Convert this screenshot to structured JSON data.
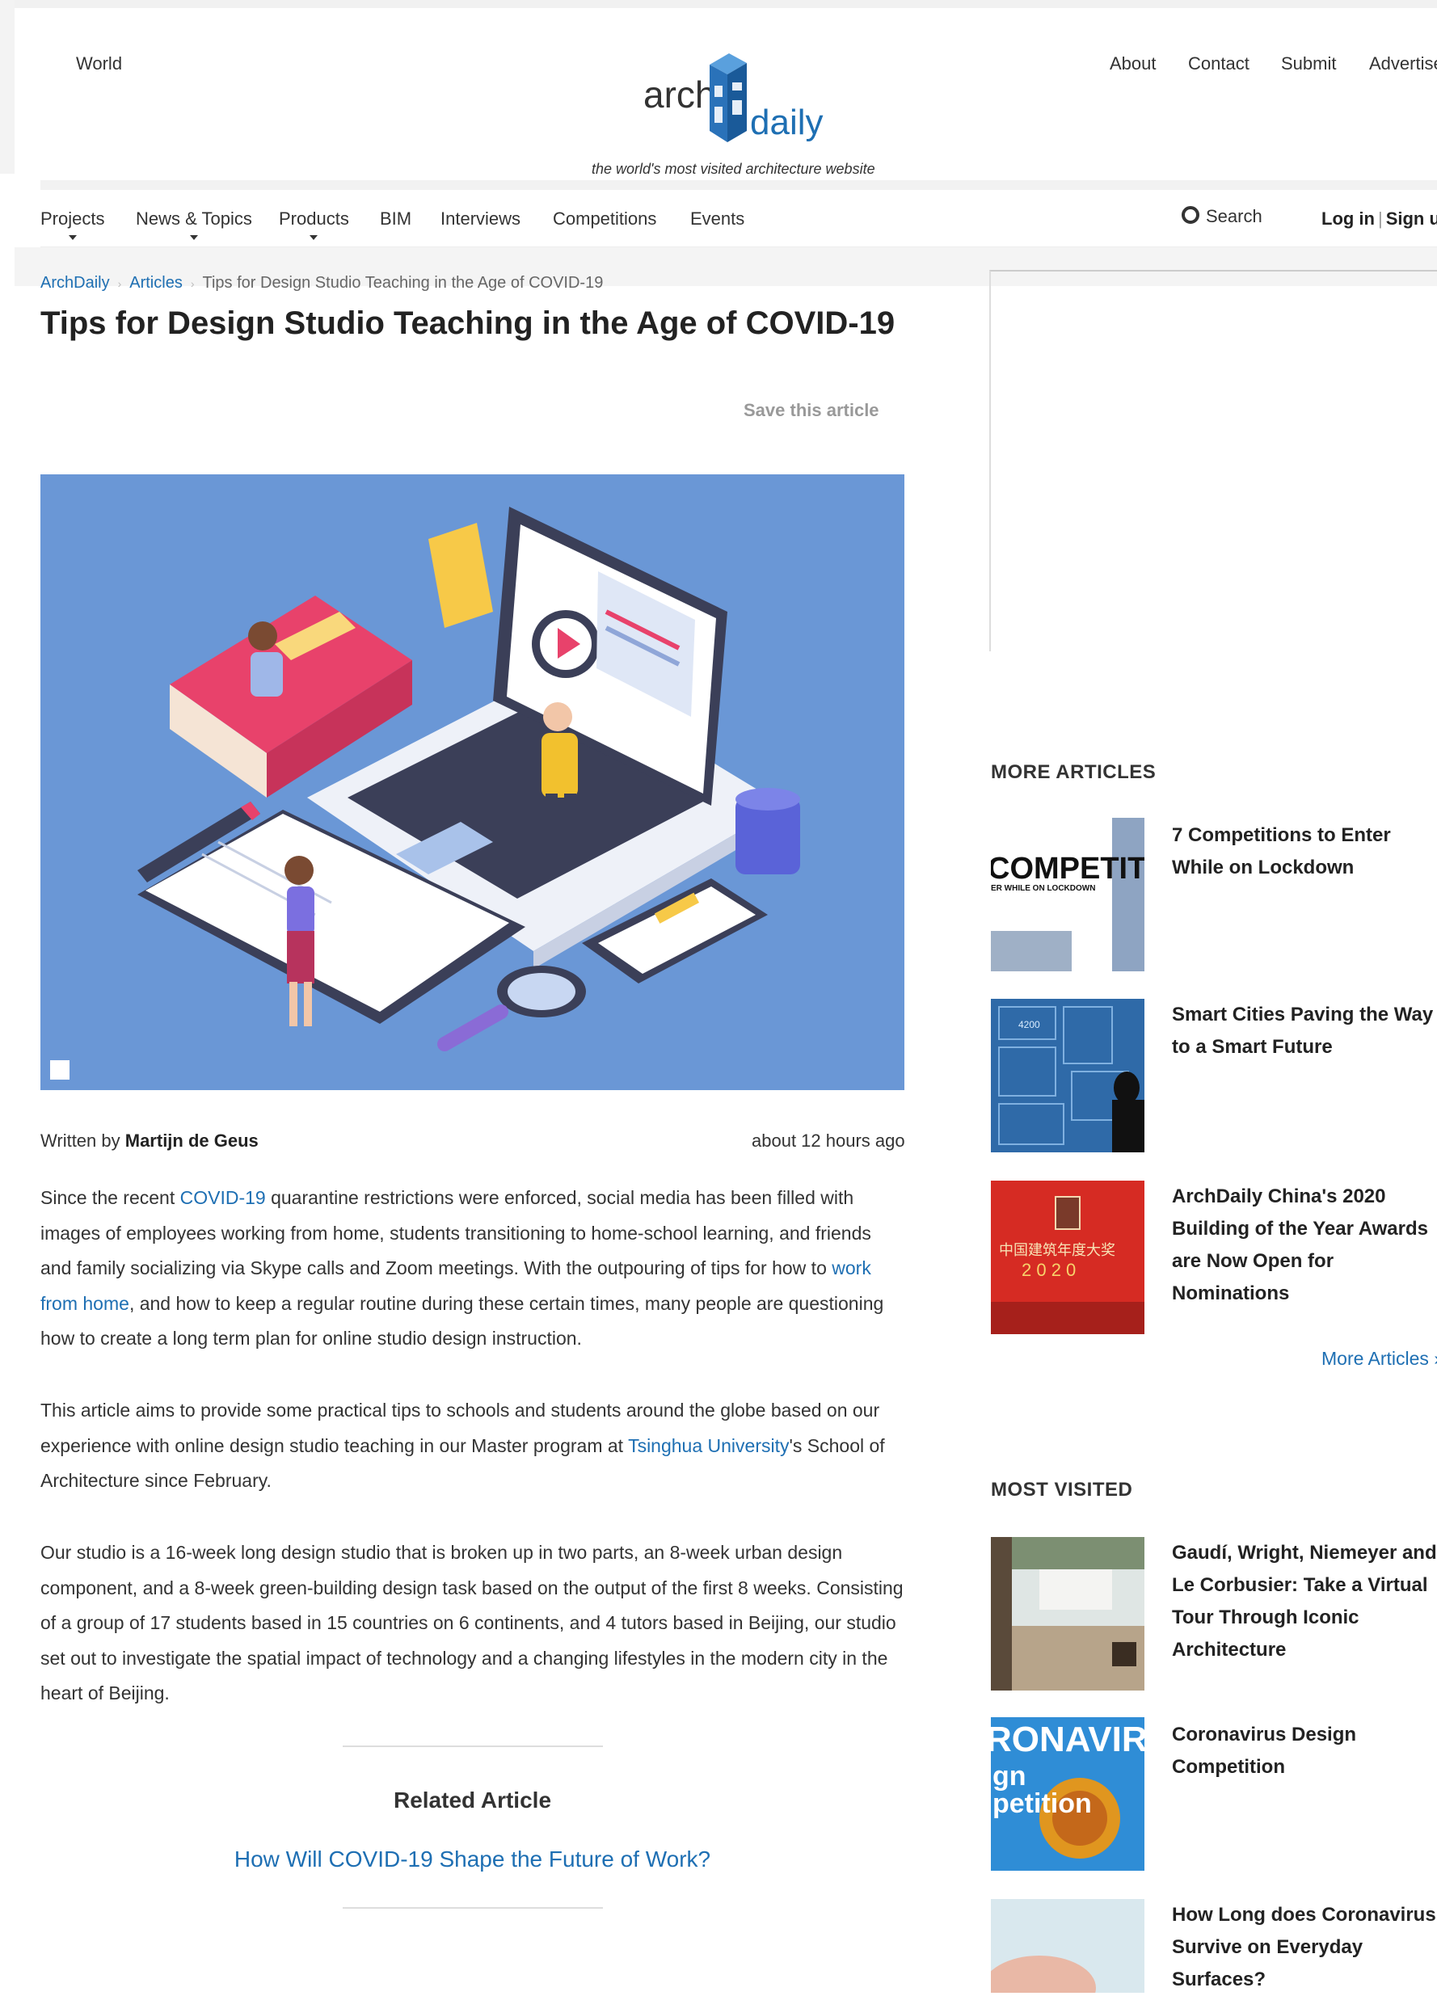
{
  "header": {
    "world_label": "World",
    "top_links": [
      "About",
      "Contact",
      "Submit",
      "Advertise"
    ],
    "logo_arch": "arch",
    "logo_daily": "daily",
    "tagline": "the world's most visited architecture website"
  },
  "nav": {
    "items": [
      {
        "label": "Projects",
        "has_menu": true
      },
      {
        "label": "News & Topics",
        "has_menu": true
      },
      {
        "label": "Products",
        "has_menu": true
      },
      {
        "label": "BIM",
        "has_menu": false
      },
      {
        "label": "Interviews",
        "has_menu": false
      },
      {
        "label": "Competitions",
        "has_menu": false
      },
      {
        "label": "Events",
        "has_menu": false
      }
    ],
    "search_label": "Search",
    "login_label": "Log in",
    "signup_label": "Sign up"
  },
  "breadcrumb": [
    "ArchDaily",
    "Articles",
    "Tips for Design Studio Teaching in the Age of COVID-19"
  ],
  "article": {
    "title": "Tips for Design Studio Teaching in the Age of COVID-19",
    "save_label": "Save this article",
    "byline_prefix": "Written by",
    "author": "Martijn de Geus",
    "posted": "about 12 hours ago",
    "p1": {
      "t1": "Since the recent ",
      "l1": "COVID-19",
      "t2": " quarantine restrictions were enforced, social media has been filled with images of employees working from home, students transitioning to home-school learning, and friends and family socializing via Skype calls and Zoom meetings. With the outpouring of tips for how to ",
      "l2": "work from home",
      "t3": ", and how to keep a regular routine during these certain times, many people are questioning how to create a long term plan for online studio design instruction."
    },
    "p2": {
      "t1": "This article aims to provide some practical tips to schools and students around the globe based on our experience with online design studio teaching in our Master program at ",
      "l1": "Tsinghua University",
      "t2": "'s School of Architecture since February."
    },
    "p3": "Our studio is a 16-week long design studio that is broken up in two parts, an 8-week urban design component, and a 8-week green-building design task based on the output of the first 8 weeks. Consisting of a group of 17 students based in 15 countries on 6 continents, and 4 tutors based in Beijing, our studio set out to investigate the spatial impact of technology and a changing lifestyles in the modern city in the heart of Beijing.",
    "related_heading": "Related Article",
    "related_link": "How Will COVID-19 Shape the Future of Work?"
  },
  "sidebar": {
    "more_articles_heading": "MORE ARTICLES",
    "more_articles": [
      {
        "title": "7 Competitions to Enter While on Lockdown",
        "thumb_text": "COMPETITIO",
        "thumb_sub": "ER WHILE ON LOCKDOWN"
      },
      {
        "title": "Smart Cities Paving the Way to a Smart Future",
        "thumb_text": "4200"
      },
      {
        "title": "ArchDaily China's 2020 Building of the Year Awards are Now Open for Nominations",
        "thumb_text": "中国建筑年度大奖",
        "thumb_year": "2 0 2 0"
      }
    ],
    "more_articles_link": "More Articles »",
    "most_visited_heading": "MOST VISITED",
    "most_visited": [
      {
        "title": "Gaudí, Wright, Niemeyer and Le Corbusier: Take a Virtual Tour Through Iconic Architecture"
      },
      {
        "title": "Coronavirus Design Competition",
        "thumb_text": "RONAVIR",
        "thumb_sub1": "gn",
        "thumb_sub2": "petition"
      },
      {
        "title": "How Long does Coronavirus Survive on Everyday Surfaces?"
      }
    ]
  },
  "colors": {
    "link": "#1e6fb3",
    "hero_bg": "#6a97d6",
    "logo_blue": "#1e6fb3"
  }
}
